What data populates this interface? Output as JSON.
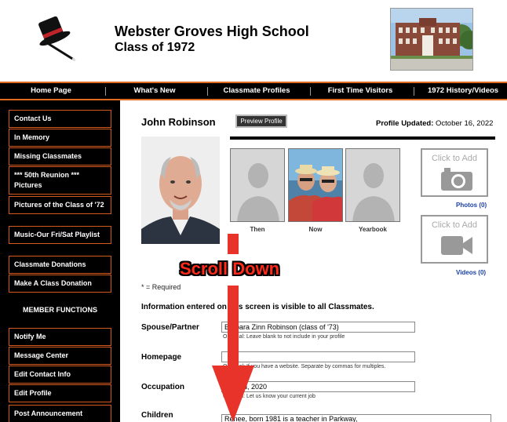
{
  "header": {
    "school_name": "Webster Groves High School",
    "class_name": "Class of 1972"
  },
  "topnav": [
    {
      "label": "Home Page"
    },
    {
      "label": "What's New"
    },
    {
      "label": "Classmate Profiles"
    },
    {
      "label": "First Time Visitors"
    },
    {
      "label": "1972 History/Videos"
    }
  ],
  "sidebar": {
    "items": [
      {
        "label": "Contact Us"
      },
      {
        "label": "In Memory"
      },
      {
        "label": "Missing Classmates"
      },
      {
        "label": "*** 50th Reunion *** Pictures"
      },
      {
        "label": "Pictures of the Class of '72"
      },
      {
        "label": "Music-Our Fri/Sat Playlist"
      },
      {
        "label": "Classmate Donations"
      },
      {
        "label": "Make A Class Donation"
      }
    ],
    "member_heading": "MEMBER FUNCTIONS",
    "member_items": [
      {
        "label": "Notify Me"
      },
      {
        "label": "Message Center"
      },
      {
        "label": "Edit Contact Info"
      },
      {
        "label": "Edit Profile"
      },
      {
        "label": "Post Announcement"
      }
    ]
  },
  "profile": {
    "name": "John Robinson",
    "preview_label": "Preview Profile",
    "updated_label": "Profile Updated:",
    "updated_date": "October 16, 2022",
    "thumbs": [
      {
        "label": "Then"
      },
      {
        "label": "Now"
      },
      {
        "label": "Yearbook"
      }
    ],
    "add_photo_text": "Click to Add",
    "photos_link": "Photos (0)",
    "add_video_text": "Click to Add",
    "videos_link": "Videos (0)"
  },
  "form": {
    "required_note": "* = Required",
    "info_line": "Information entered on this screen is visible to all Classmates.",
    "fields": [
      {
        "label": "Spouse/Partner",
        "value": "Barbara Zinn Robinson (class of '73)",
        "hint": "Optional: Leave blank to not include in your profile"
      },
      {
        "label": "Homepage",
        "value": "",
        "hint": "Optional: If you have a website. Separate by commas for multiples."
      },
      {
        "label": "Occupation",
        "value": "Retired, 2020",
        "hint": "Optional: Let us know your current job"
      },
      {
        "label": "Children",
        "value": "Renee, born 1981 is a teacher in Parkway,",
        "hint": ""
      }
    ]
  },
  "overlay": {
    "scroll_text": "Scroll Down",
    "arrow_color": "#e8332a"
  },
  "colors": {
    "accent": "#e06a20",
    "nav_bg": "#000000",
    "link": "#1a3fa8"
  }
}
